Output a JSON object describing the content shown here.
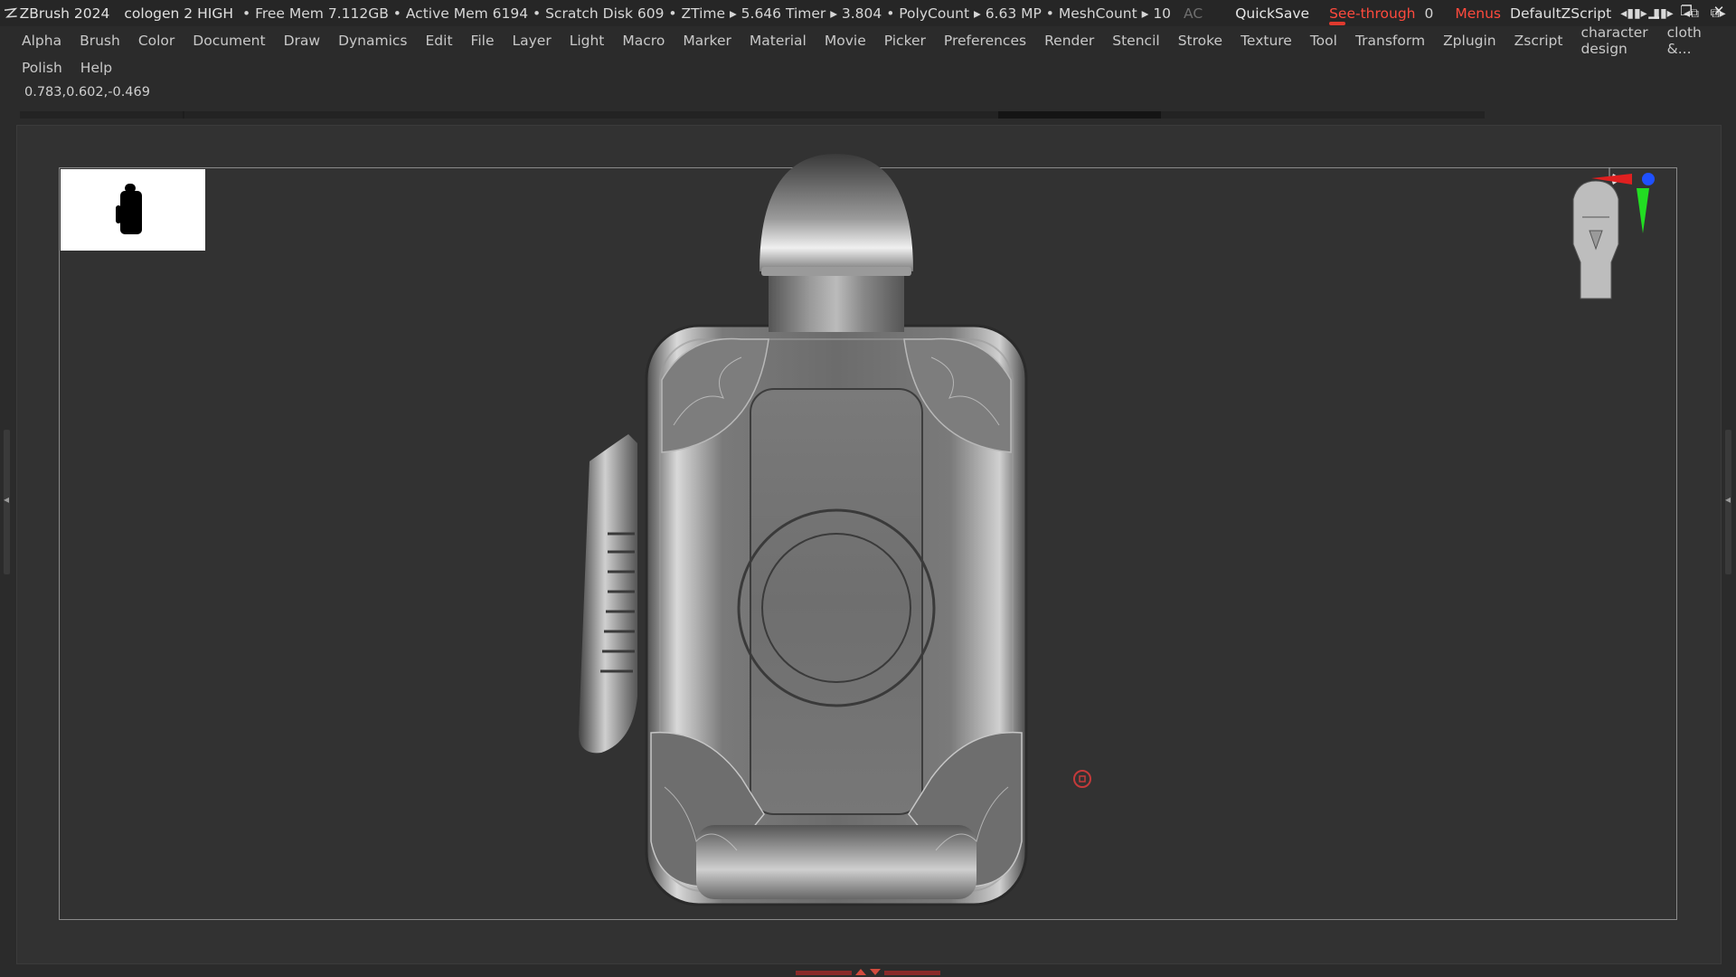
{
  "titlebar": {
    "app_name": "ZBrush 2024",
    "document_name": "cologen 2 HIGH",
    "stats": "• Free Mem 7.112GB • Active Mem 6194 • Scratch Disk 609 •  ZTime ▸ 5.646 Timer ▸ 3.804 • PolyCount ▸ 6.63 MP  • MeshCount ▸ 10",
    "ac_label": "AC",
    "quicksave_label": "QuickSave",
    "seethrough_label": "See-through",
    "seethrough_value": "0",
    "menus_label": "Menus",
    "script_label": "DefaultZScript",
    "accent_color": "#ff4a3d"
  },
  "menubar": {
    "row1": [
      "Alpha",
      "Brush",
      "Color",
      "Document",
      "Draw",
      "Dynamics",
      "Edit",
      "File",
      "Layer",
      "Light",
      "Macro",
      "Marker",
      "Material",
      "Movie",
      "Picker",
      "Preferences",
      "Render",
      "Stencil",
      "Stroke",
      "Texture",
      "Tool",
      "Transform",
      "Zplugin",
      "Zscript",
      "character design",
      "cloth &..."
    ],
    "row2": [
      "Polish",
      "Help"
    ]
  },
  "status": {
    "coordinates": "0.783,0.602,-0.469"
  },
  "icons": {
    "app_logo": "zbrush-logo-icon",
    "navigation_thumbnail": "bottle-silhouette-icon",
    "orientation_gizmo": "head-orientation-icon",
    "window_controls": [
      "minimize-icon",
      "restore-icon",
      "close-icon"
    ]
  },
  "viewport": {
    "model": "perfume bottle sculpt",
    "background_color": "#323232"
  }
}
